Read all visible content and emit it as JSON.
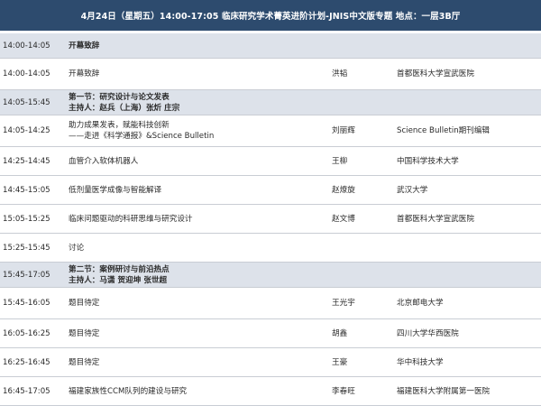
{
  "header": {
    "text": "4月24日（星期五）14:00-17:05   临床研究学术菁英进阶计划-JNIS中文版专题     地点：一层3B厅"
  },
  "rows": [
    {
      "type": "section",
      "time": "14:00-14:05",
      "title": [
        "开幕致辞"
      ],
      "speaker": "",
      "institution": ""
    },
    {
      "type": "item",
      "time": "14:00-14:05",
      "title": [
        "开幕致辞"
      ],
      "speaker": "洪韬",
      "institution": "首都医科大学宣武医院"
    },
    {
      "type": "section",
      "time": "14:05-15:45",
      "title": [
        "第一节：研究设计与论文发表",
        "主持人：赵兵（上海）张炘  庄宗"
      ],
      "speaker": "",
      "institution": ""
    },
    {
      "type": "item",
      "time": "14:05-14:25",
      "title": [
        "助力成果发表，赋能科技创新",
        "——走进《科学通报》&Science Bulletin"
      ],
      "speaker": "刘丽辉",
      "institution": "Science Bulletin期刊编辑"
    },
    {
      "type": "item",
      "time": "14:25-14:45",
      "title": [
        "血管介入软体机器人"
      ],
      "speaker": "王柳",
      "institution": "中国科学技术大学"
    },
    {
      "type": "item",
      "time": "14:45-15:05",
      "title": [
        "低剂量医学成像与智能解译"
      ],
      "speaker": "赵燎旋",
      "institution": "武汉大学"
    },
    {
      "type": "item",
      "time": "15:05-15:25",
      "title": [
        "临床问题驱动的科研思维与研究设计"
      ],
      "speaker": "赵文博",
      "institution": "首都医科大学宣武医院"
    },
    {
      "type": "item",
      "time": "15:25-15:45",
      "title": [
        "讨论"
      ],
      "speaker": "",
      "institution": ""
    },
    {
      "type": "section",
      "time": "15:45-17:05",
      "title": [
        "第二节：案例研讨与前沿热点",
        "主持人：马潇  贺迎坤  张世超"
      ],
      "speaker": "",
      "institution": ""
    },
    {
      "type": "item",
      "time": "15:45-16:05",
      "title": [
        "题目待定"
      ],
      "speaker": "王光宇",
      "institution": "北京邮电大学"
    },
    {
      "type": "item",
      "time": "16:05-16:25",
      "title": [
        "题目待定"
      ],
      "speaker": "胡鑫",
      "institution": "四川大学华西医院"
    },
    {
      "type": "item",
      "time": "16:25-16:45",
      "title": [
        "题目待定"
      ],
      "speaker": "王豪",
      "institution": "华中科技大学"
    },
    {
      "type": "item",
      "time": "16:45-17:05",
      "title": [
        "福建家族性CCM队列的建设与研究"
      ],
      "speaker": "李春旺",
      "institution": "福建医科大学附属第一医院"
    }
  ]
}
